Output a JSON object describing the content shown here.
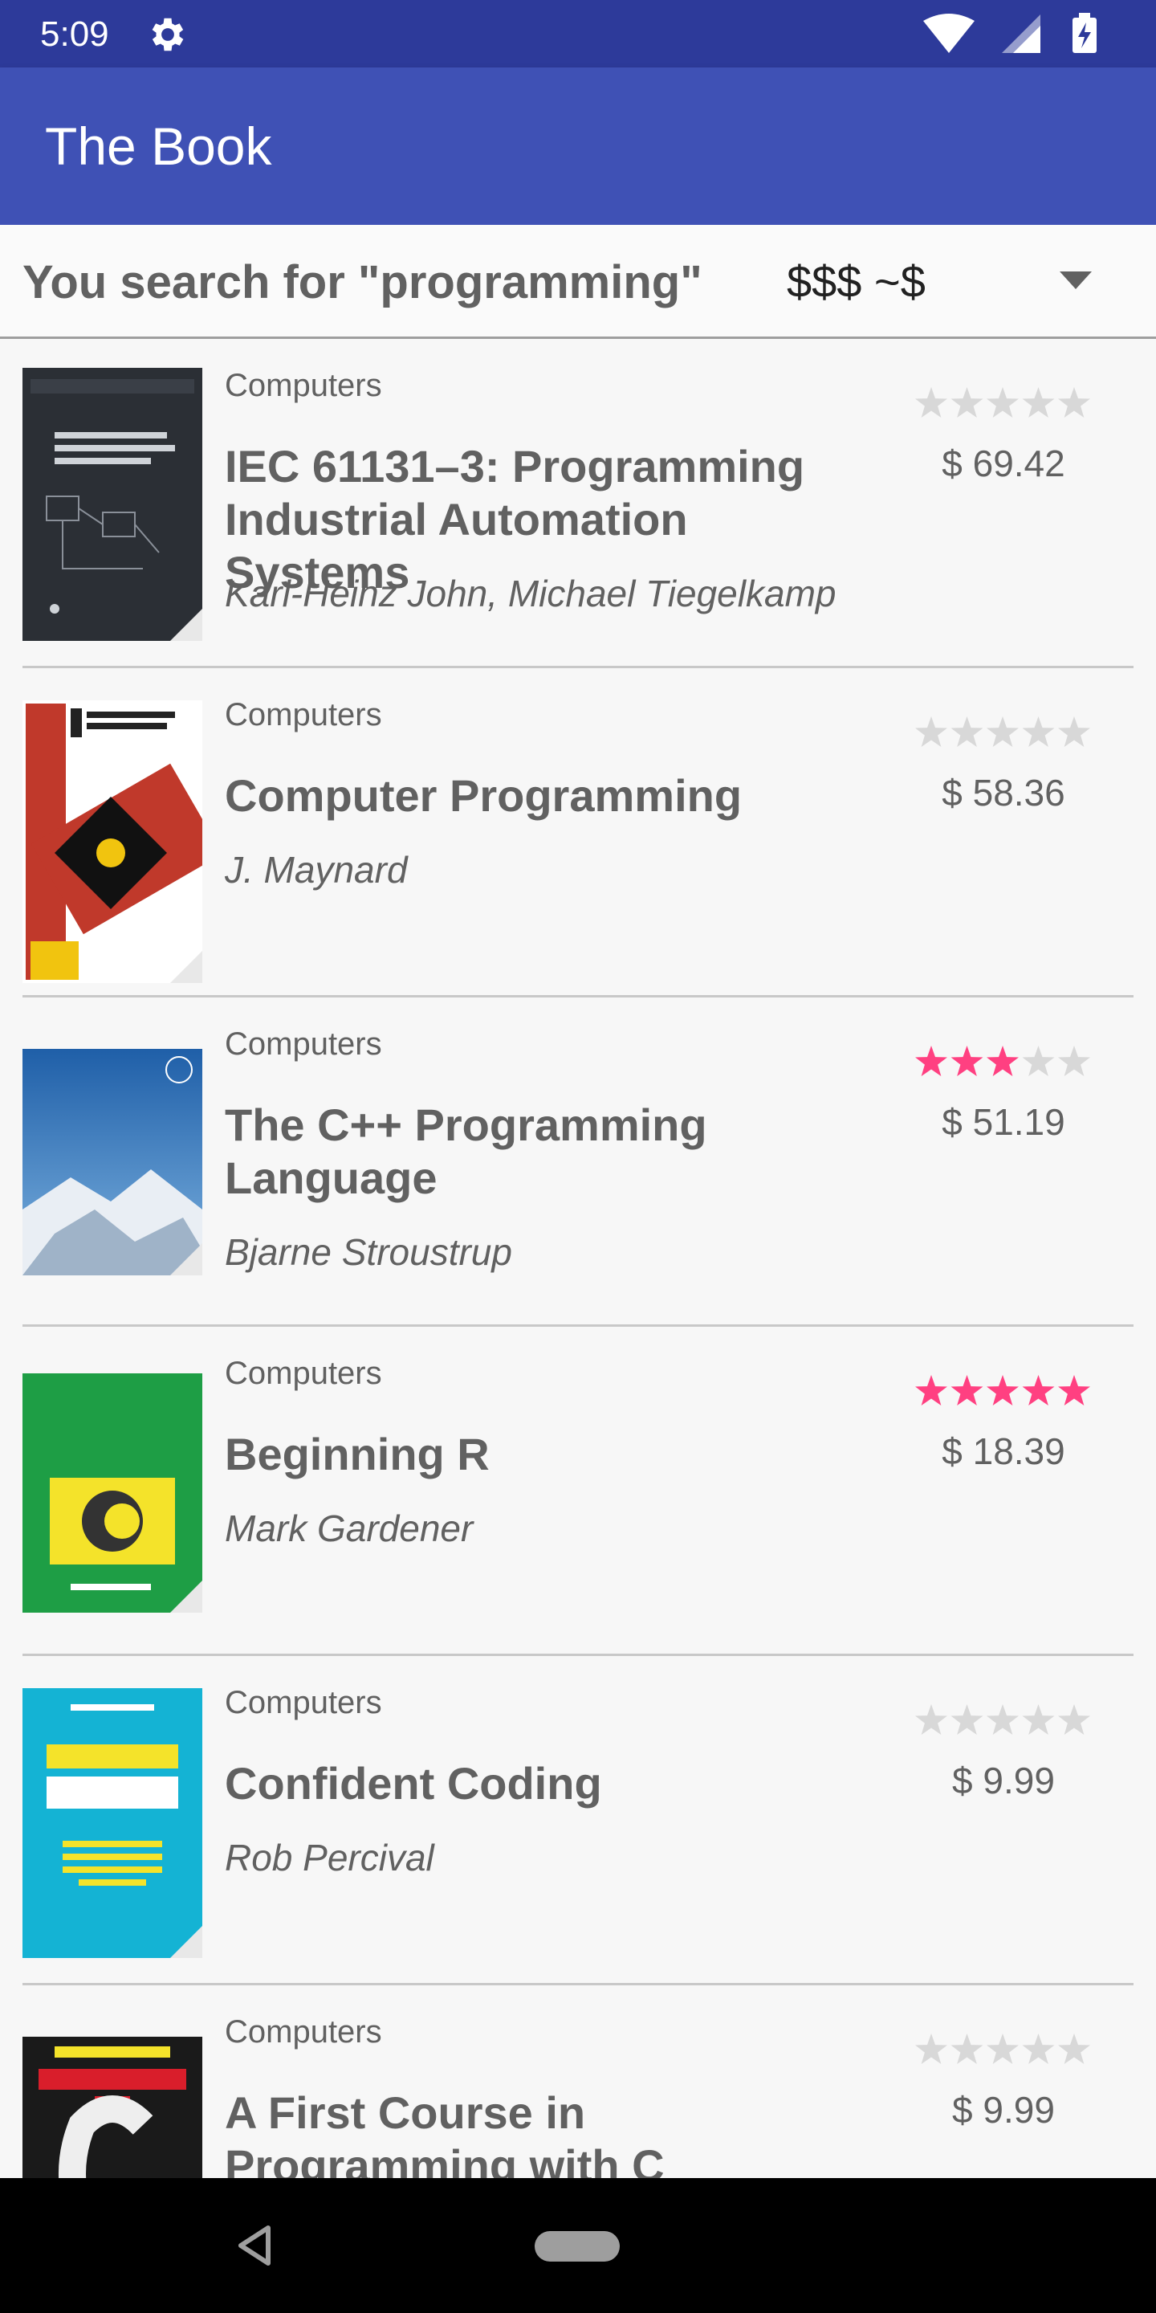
{
  "status_bar": {
    "time": "5:09"
  },
  "app_bar": {
    "title": "The Book"
  },
  "search": {
    "label": "You search for \"programming\"",
    "sort_value": "$$$ ~$"
  },
  "colors": {
    "primary": "#3f51b5",
    "primary_dark": "#2d3a9a",
    "star_active": "#ff4081",
    "star_inactive": "#d8d8d8"
  },
  "books": [
    {
      "category": "Computers",
      "title": "IEC 61131–3: Programming Industrial Automation Systems",
      "author": "Karl-Heinz John, Michael Tiegelkamp",
      "rating": 0,
      "price": "$ 69.42",
      "cover": "Springer IEC 61131-3 cover"
    },
    {
      "category": "Computers",
      "title": "Computer Programming",
      "author": "J. Maynard",
      "rating": 0,
      "price": "$ 58.36",
      "cover": "Computer Programming cover"
    },
    {
      "category": "Computers",
      "title": "The C++ Programming Language",
      "author": "Bjarne Stroustrup",
      "rating": 3,
      "price": "$ 51.19",
      "cover": "C++ mountain cover"
    },
    {
      "category": "Computers",
      "title": "Beginning R",
      "author": "Mark Gardener",
      "rating": 5,
      "price": "$ 18.39",
      "cover": "Computer Programming in C cover"
    },
    {
      "category": "Computers",
      "title": "Confident Coding",
      "author": "Rob Percival",
      "rating": 0,
      "price": "$ 9.99",
      "cover": "Confident Coding cover"
    },
    {
      "category": "Computers",
      "title": "A First Course in Programming with C",
      "author": "",
      "rating": 0,
      "price": "$ 9.99",
      "cover": "Programming with C cover"
    }
  ]
}
